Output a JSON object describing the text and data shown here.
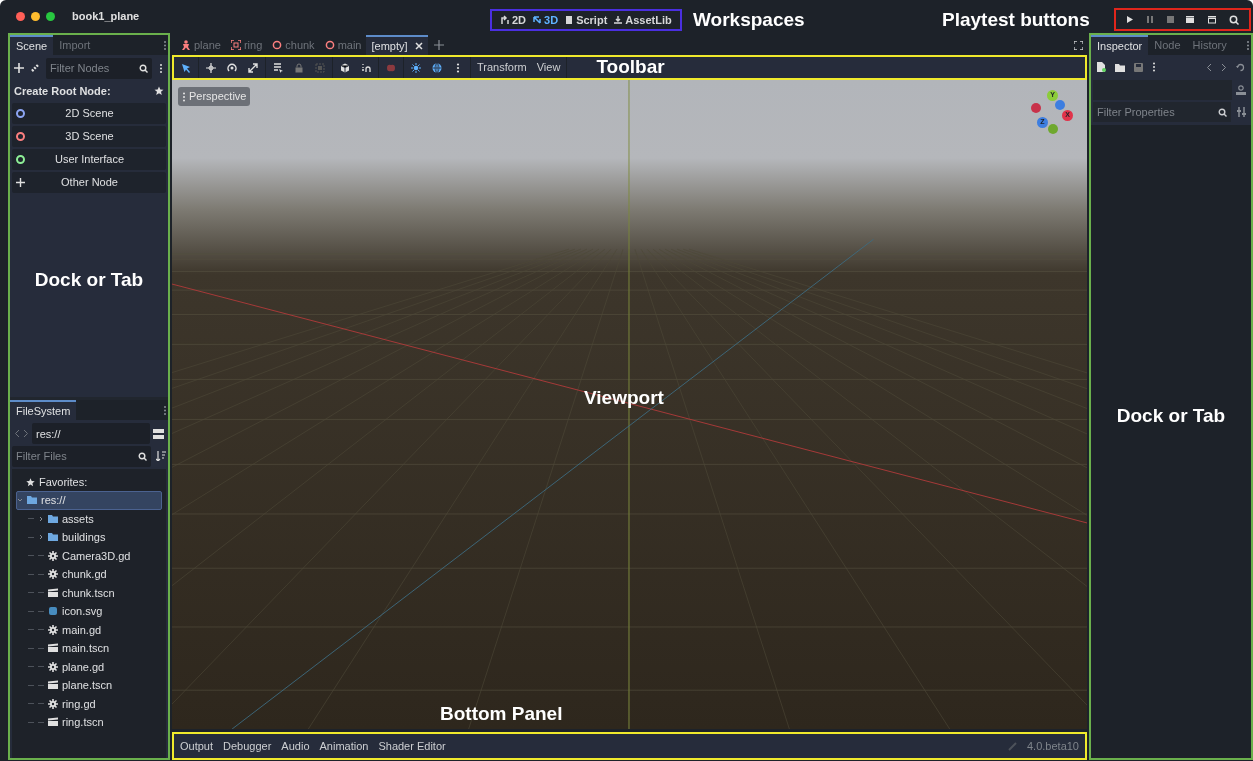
{
  "window": {
    "title": "book1_plane"
  },
  "workspaces": [
    {
      "label": "2D",
      "kind": "planar",
      "selected": false
    },
    {
      "label": "3D",
      "kind": "spatial",
      "selected": true
    },
    {
      "label": "Script",
      "kind": "script",
      "selected": false
    },
    {
      "label": "AssetLib",
      "kind": "assetlib",
      "selected": false
    }
  ],
  "annotations": {
    "workspaces": "Workspaces",
    "playtest": "Playtest buttons",
    "toolbar": "Toolbar",
    "left_dock": "Dock or Tab",
    "right_dock": "Dock or Tab",
    "viewport": "Viewport",
    "bottom_panel": "Bottom Panel"
  },
  "scene_dock": {
    "tabs": [
      {
        "label": "Scene",
        "selected": true
      },
      {
        "label": "Import",
        "selected": false
      }
    ],
    "filter": {
      "placeholder": "Filter Nodes"
    },
    "create_root_label": "Create Root Node:",
    "root_options": [
      {
        "label": "2D Scene",
        "kind": "circle",
        "color": "#8da5f3"
      },
      {
        "label": "3D Scene",
        "kind": "circle",
        "color": "#fc7f7f"
      },
      {
        "label": "User Interface",
        "kind": "circle",
        "color": "#8eef97"
      },
      {
        "label": "Other Node",
        "kind": "plus"
      }
    ]
  },
  "filesystem": {
    "tab": "FileSystem",
    "path": "res://",
    "filter": {
      "placeholder": "Filter Files"
    },
    "favorites": "Favorites:",
    "tree": [
      {
        "label": "res://",
        "kind": "folder",
        "selected": true,
        "expanded": true,
        "children": [
          {
            "label": "assets",
            "kind": "folder",
            "selected": false,
            "expanded": false
          },
          {
            "label": "buildings",
            "kind": "folder",
            "selected": false,
            "expanded": false
          },
          {
            "label": "Camera3D.gd",
            "kind": "script",
            "selected": false
          },
          {
            "label": "chunk.gd",
            "kind": "script",
            "selected": false
          },
          {
            "label": "chunk.tscn",
            "kind": "scene",
            "selected": false
          },
          {
            "label": "icon.svg",
            "kind": "image",
            "selected": false
          },
          {
            "label": "main.gd",
            "kind": "script",
            "selected": false
          },
          {
            "label": "main.tscn",
            "kind": "scene",
            "selected": false
          },
          {
            "label": "plane.gd",
            "kind": "script",
            "selected": false
          },
          {
            "label": "plane.tscn",
            "kind": "scene",
            "selected": false
          },
          {
            "label": "ring.gd",
            "kind": "script",
            "selected": false
          },
          {
            "label": "ring.tscn",
            "kind": "scene",
            "selected": false
          }
        ]
      }
    ]
  },
  "scene_tabs": [
    {
      "label": "plane",
      "kind": "character",
      "selected": false
    },
    {
      "label": "ring",
      "kind": "mesh",
      "selected": false
    },
    {
      "label": "chunk",
      "kind": "node3d",
      "selected": false
    },
    {
      "label": "main",
      "kind": "node3d",
      "selected": false
    },
    {
      "label": "[empty]",
      "kind": "none",
      "selected": true
    }
  ],
  "toolbar": {
    "menus": [
      "Transform",
      "View"
    ]
  },
  "viewport": {
    "view_label": "Perspective",
    "gizmo": [
      "Y",
      "X",
      "Z"
    ]
  },
  "inspector": {
    "tabs": [
      {
        "label": "Inspector",
        "selected": true
      },
      {
        "label": "Node",
        "selected": false
      },
      {
        "label": "History",
        "selected": false
      }
    ],
    "filter": {
      "placeholder": "Filter Properties"
    }
  },
  "bottom_panel": {
    "tabs": [
      "Output",
      "Debugger",
      "Audio",
      "Animation",
      "Shader Editor"
    ],
    "version": "4.0.beta10"
  }
}
